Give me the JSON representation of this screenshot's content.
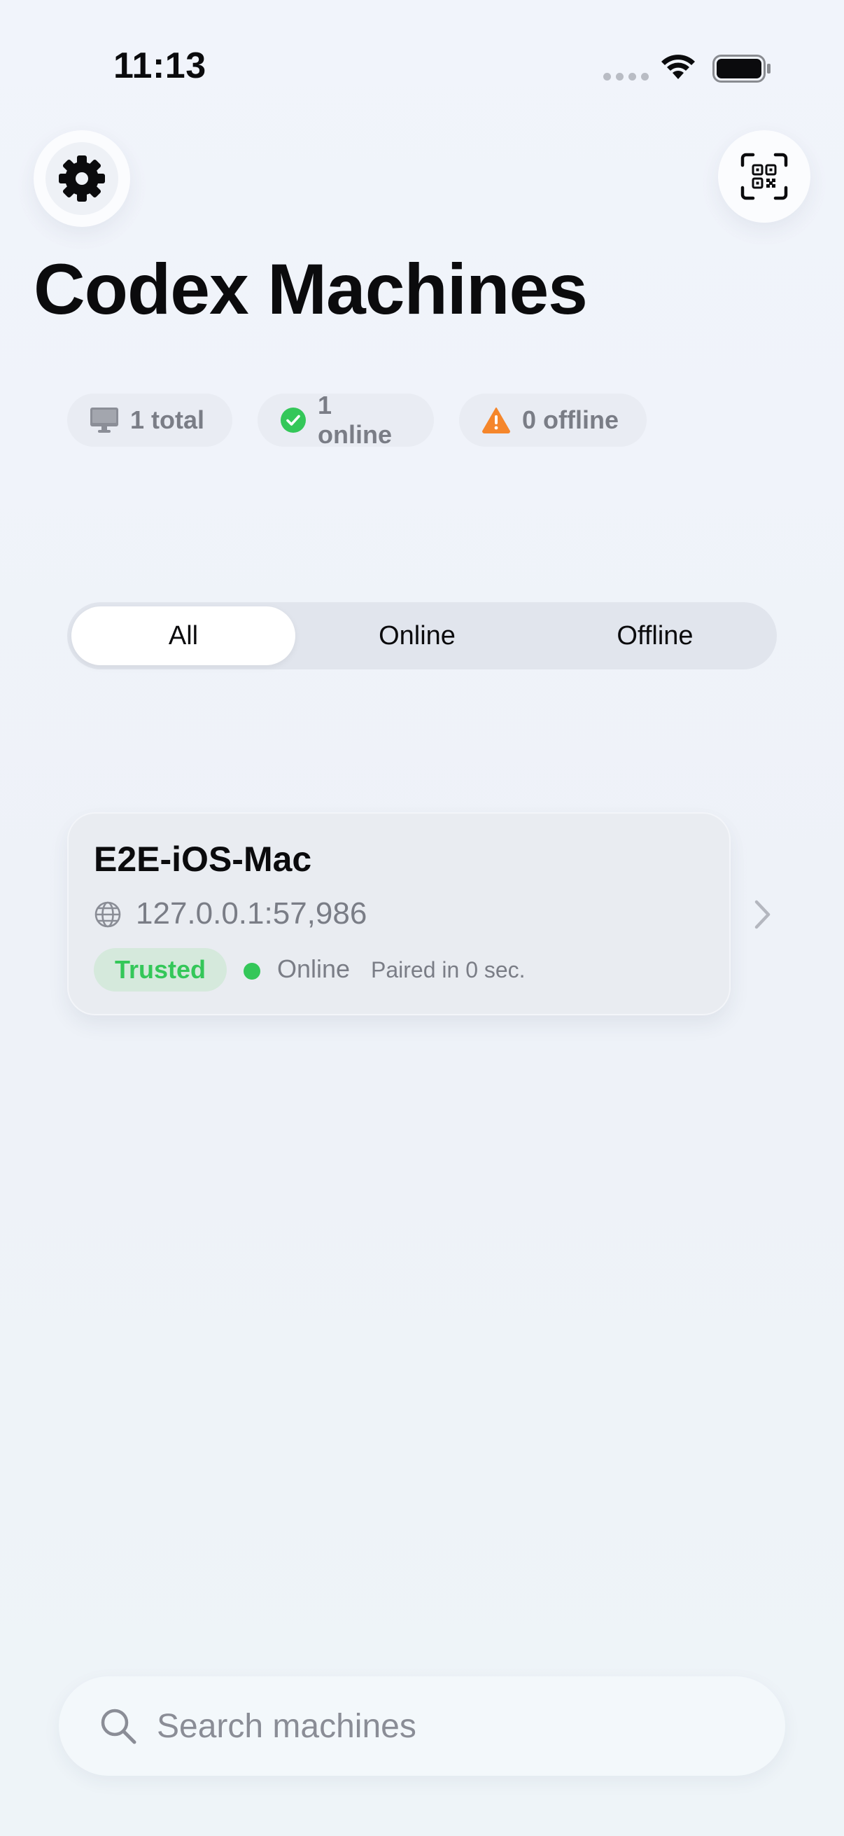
{
  "status_bar": {
    "time": "11:13"
  },
  "header": {
    "title": "Codex Machines",
    "settings_icon": "gear-icon",
    "scan_icon": "qr-code-scan-icon"
  },
  "stats": {
    "total": "1 total",
    "online": "1 online",
    "offline": "0 offline",
    "online_color": "#34c759",
    "offline_color": "#f5862b"
  },
  "filter": {
    "options": [
      "All",
      "Online",
      "Offline"
    ],
    "selected": "All"
  },
  "machines": [
    {
      "name": "E2E-iOS-Mac",
      "address": "127.0.0.1:57,986",
      "trust": "Trusted",
      "status": "Online",
      "paired": "Paired in 0 sec."
    }
  ],
  "search": {
    "placeholder": "Search machines"
  },
  "colors": {
    "accent_green": "#34c759",
    "warning_orange": "#f5862b",
    "background": "#f0f3f9"
  }
}
